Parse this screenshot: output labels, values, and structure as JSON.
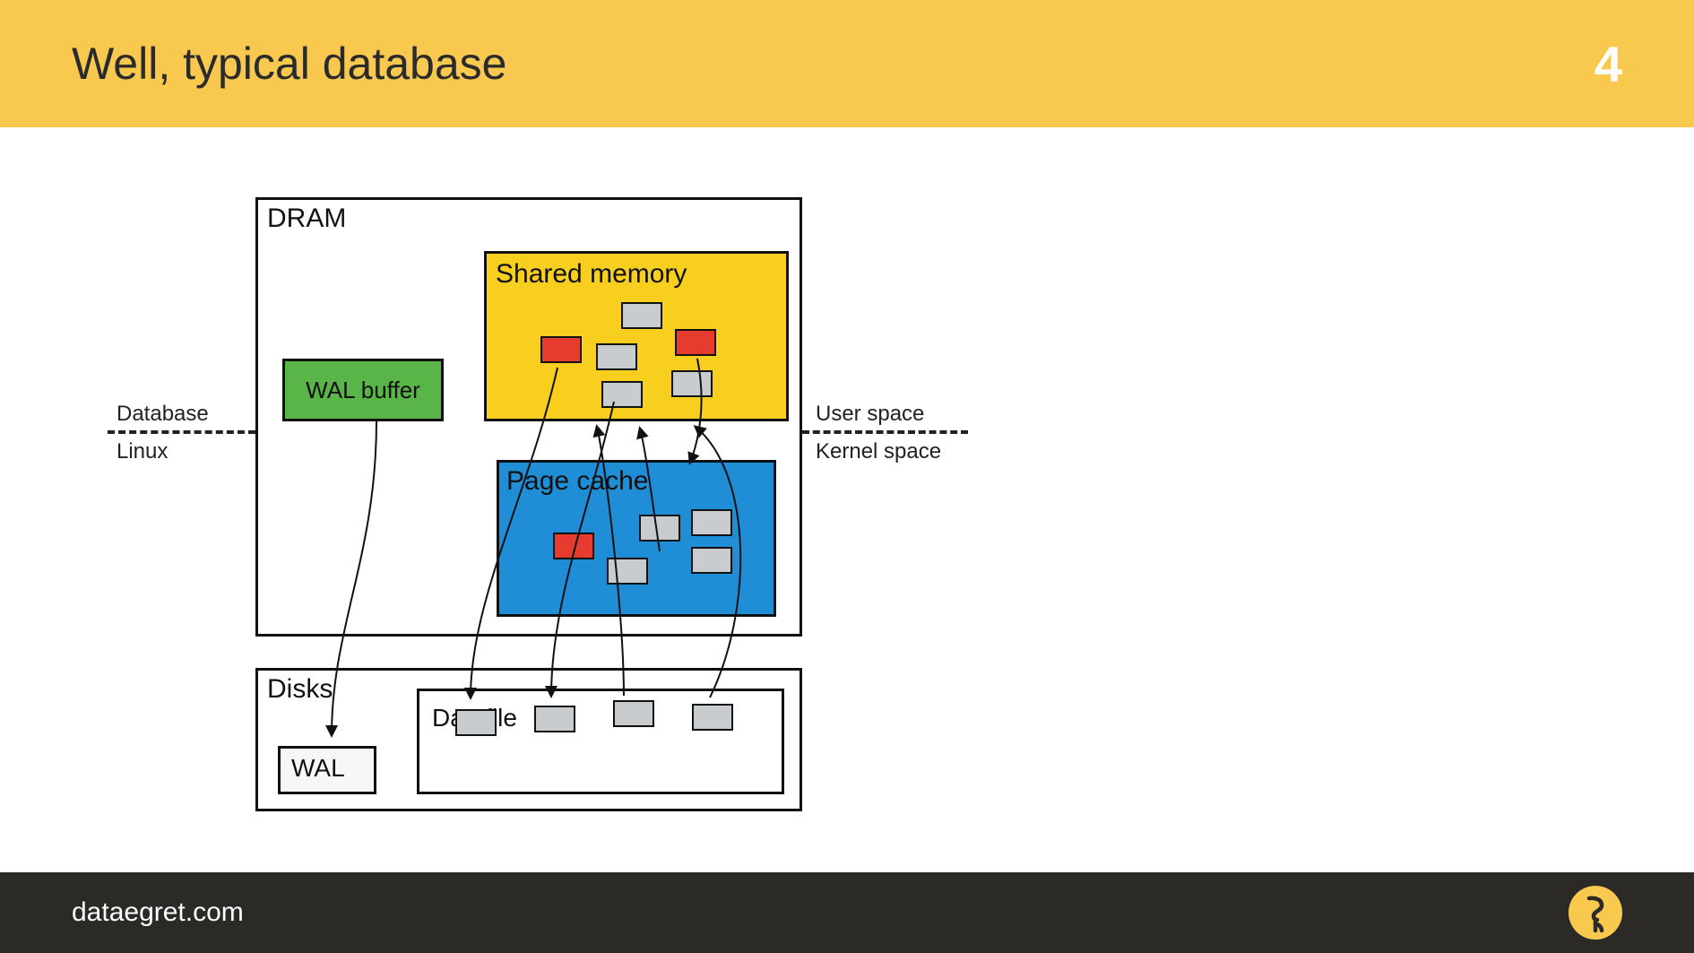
{
  "header": {
    "title": "Well, typical database",
    "page_number": "4"
  },
  "footer": {
    "site": "dataegret.com"
  },
  "colors": {
    "accent": "#f8c94e",
    "footer": "#2b2a27",
    "green": "#59b547",
    "yellow": "#f8cf1e",
    "blue": "#1f8ed6",
    "red": "#e63c2f",
    "gray": "#c9ccce"
  },
  "diagram": {
    "dram_label": "DRAM",
    "wal_buffer_label": "WAL buffer",
    "shared_mem_label": "Shared memory",
    "page_cache_label": "Page cache",
    "disks_label": "Disks",
    "wal_box_label": "WAL",
    "datafile_label": "Datafile",
    "labels": {
      "upper_left": "Database",
      "lower_left": "Linux",
      "upper_right": "User space",
      "lower_right": "Kernel space"
    }
  }
}
